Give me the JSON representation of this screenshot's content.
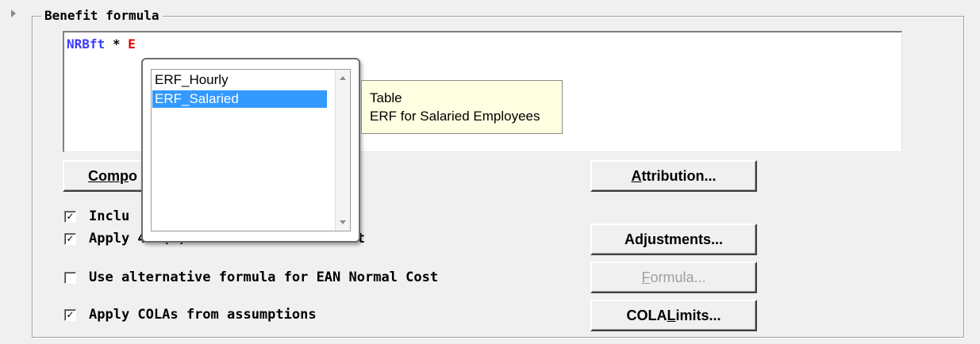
{
  "group": {
    "title": "Benefit formula"
  },
  "formula": {
    "var": "NRBft",
    "op": "*",
    "pending": "E"
  },
  "buttons": {
    "components": {
      "label_ul": "Comp",
      "label_rest": "o"
    },
    "attribution": {
      "label_ul": "A",
      "label_rest": "ttribution..."
    },
    "adjustments": {
      "label": "Adjustments..."
    },
    "formula": {
      "label_ul": "F",
      "label_rest": "ormula..."
    },
    "cola_limits": {
      "label_pre": "COLA ",
      "label_ul": "L",
      "label_rest": "imits..."
    }
  },
  "checkboxes": [
    {
      "label": "Inclu                      ies",
      "checked": true,
      "mark": "✓"
    },
    {
      "label": "Apply 415(b) maximum benefit limit",
      "checked": true,
      "mark": "✓"
    },
    {
      "label": "Use alternative formula for EAN Normal Cost",
      "checked": false,
      "mark": ""
    },
    {
      "label": "Apply COLAs from assumptions",
      "checked": true,
      "mark": "✓"
    }
  ],
  "popup": {
    "items": [
      "ERF_Hourly",
      "ERF_Salaried"
    ],
    "selected_index": 1
  },
  "tooltip": {
    "line1": "Table",
    "line2": "ERF for Salaried Employees"
  },
  "colors": {
    "selection": "#3399ff",
    "tooltip_bg": "#ffffe1",
    "formula_var": "#3c3cff",
    "formula_pending": "#e00000"
  }
}
